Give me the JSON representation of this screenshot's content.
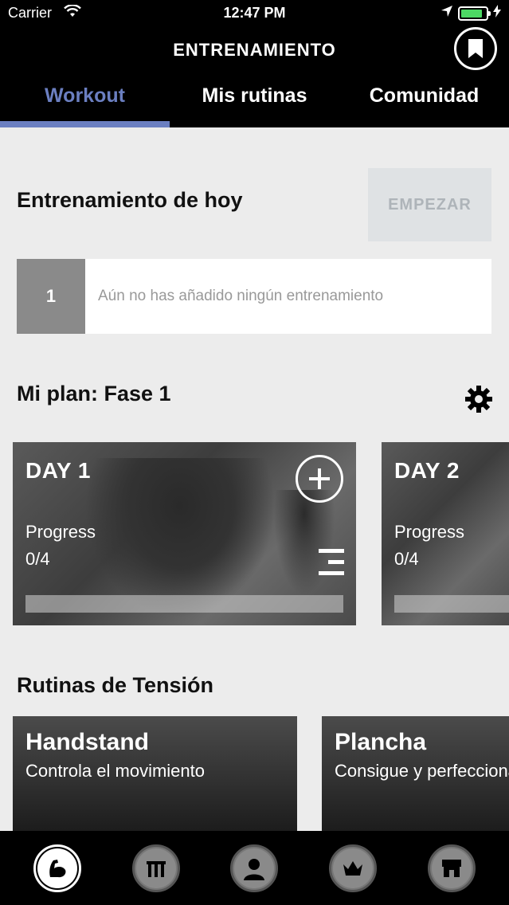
{
  "status_bar": {
    "carrier": "Carrier",
    "time": "12:47 PM",
    "battery_level": 0.85
  },
  "header": {
    "title": "ENTRENAMIENTO"
  },
  "tabs": [
    {
      "label": "Workout",
      "active": true
    },
    {
      "label": "Mis rutinas",
      "active": false
    },
    {
      "label": "Comunidad",
      "active": false
    }
  ],
  "today": {
    "heading": "Entrenamiento de hoy",
    "start_label": "EMPEZAR",
    "number": "1",
    "empty_message": "Aún no has añadido ningún entrenamiento"
  },
  "plan": {
    "heading": "Mi plan: Fase 1",
    "days": [
      {
        "label": "DAY 1",
        "progress_label": "Progress",
        "progress_value": "0/4",
        "progress": 0
      },
      {
        "label": "DAY 2",
        "progress_label": "Progress",
        "progress_value": "0/4",
        "progress": 0
      }
    ]
  },
  "tension": {
    "heading": "Rutinas de Tensión",
    "cards": [
      {
        "title": "Handstand",
        "subtitle": "Controla el movimiento"
      },
      {
        "title": "Plancha",
        "subtitle": "Consigue y perfecciona"
      }
    ]
  },
  "bottom_nav": [
    {
      "icon": "flexed-arm-icon",
      "active": true
    },
    {
      "icon": "bars-icon",
      "active": false
    },
    {
      "icon": "person-icon",
      "active": false
    },
    {
      "icon": "crown-icon",
      "active": false
    },
    {
      "icon": "store-icon",
      "active": false
    }
  ],
  "colors": {
    "accent": "#6b7fc1",
    "battery": "#4cd964"
  }
}
